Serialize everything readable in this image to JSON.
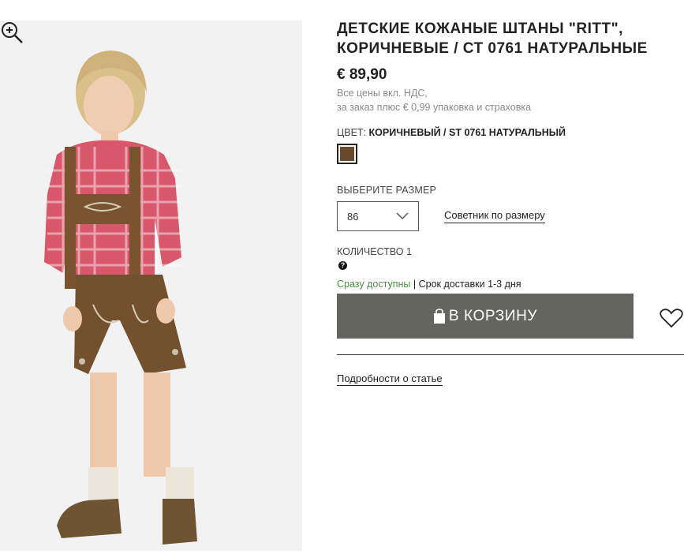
{
  "product": {
    "title_line1": "ДЕТСКИЕ КОЖАНЫЕ ШТАНЫ \"RITT\",",
    "title_line2": "КОРИЧНЕВЫЕ / СТ 0761 НАТУРАЛЬНЫЕ",
    "price": "€ 89,90",
    "vat_note": "Все цены вкл. НДС,",
    "shipping_note": "за заказ плюс € 0,99 упаковка и страховка"
  },
  "color": {
    "label": "ЦВЕТ:",
    "value": "КОРИЧНЕВЫЙ / ST 0761 НАТУРАЛЬНЫЙ",
    "swatch_hex": "#6b4a2b"
  },
  "size": {
    "label": "ВЫБЕРИТЕ РАЗМЕР",
    "selected": "86",
    "advisor_link": "Советник по размеру"
  },
  "quantity": {
    "label": "КОЛИЧЕСТВО 1",
    "help_icon": "?"
  },
  "availability": {
    "status": "Сразу доступны",
    "separator": "|",
    "delivery": "Срок доставки 1-3 дня",
    "status_color": "#4e8a45"
  },
  "actions": {
    "add_to_cart": "В КОРЗИНУ",
    "cart_icon": "shopping-bag-icon",
    "wishlist_icon": "heart-icon"
  },
  "details_link": "Подробности о статье",
  "image": {
    "zoom_icon": "zoom-in-icon"
  },
  "colors": {
    "button_bg": "#64655f",
    "image_bg": "#f2f2f2"
  }
}
